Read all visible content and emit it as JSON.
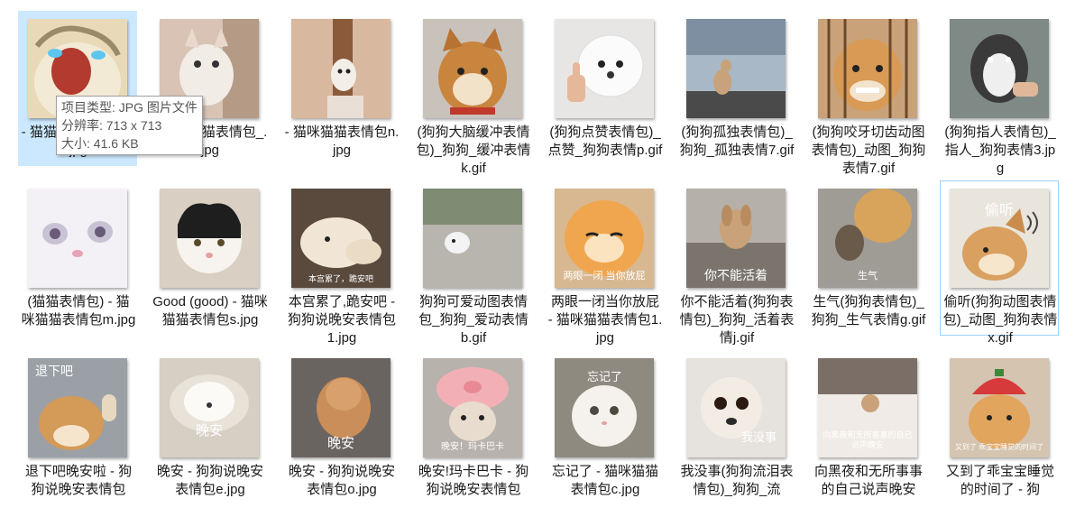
{
  "tooltip": {
    "type": "项目类型: JPG 图片文件",
    "resolution": "分辨率: 713 x 713",
    "size": "大小: 41.6 KB"
  },
  "files": [
    {
      "name": "- 猫猫猫猫表情包_.jpg",
      "overlay": ""
    },
    {
      "name": "- 猫咪猫猫表情包_.jpg",
      "overlay": ""
    },
    {
      "name": "- 猫咪猫猫表情包n.jpg",
      "overlay": ""
    },
    {
      "name": "(狗狗大脑缓冲表情包)_狗狗_缓冲表情k.gif",
      "overlay": ""
    },
    {
      "name": "(狗狗点赞表情包)_点赞_狗狗表情p.gif",
      "overlay": ""
    },
    {
      "name": "(狗狗孤独表情包)_狗狗_孤独表情7.gif",
      "overlay": ""
    },
    {
      "name": "(狗狗咬牙切齿动图表情包)_动图_狗狗表情7.gif",
      "overlay": ""
    },
    {
      "name": "(狗狗指人表情包)_指人_狗狗表情3.jpg",
      "overlay": ""
    },
    {
      "name": "(猫猫表情包) - 猫咪猫猫表情包m.jpg",
      "overlay": ""
    },
    {
      "name": "Good (good) - 猫咪猫猫表情包s.jpg",
      "overlay": ""
    },
    {
      "name": "本宫累了,跪安吧 - 狗狗说晚安表情包1.jpg",
      "overlay": "本宫累了，跪安吧"
    },
    {
      "name": "狗狗可爱动图表情包_狗狗_爱动表情b.gif",
      "overlay": ""
    },
    {
      "name": "两眼一闭当你放屁 - 猫咪猫猫表情包1.jpg",
      "overlay": "两眼一闭 当你放屁"
    },
    {
      "name": "你不能活着(狗狗表情包)_狗狗_活着表情j.gif",
      "overlay": "你不能活着"
    },
    {
      "name": "生气(狗狗表情包)_狗狗_生气表情g.gif",
      "overlay": "生气"
    },
    {
      "name": "偷听(狗狗动图表情包)_动图_狗狗表情x.gif",
      "overlay": "偷听"
    },
    {
      "name": "退下吧晚安啦 - 狗狗说晚安表情包",
      "overlay": "退下吧"
    },
    {
      "name": "晚安 - 狗狗说晚安表情包e.jpg",
      "overlay": "晚安"
    },
    {
      "name": "晚安 - 狗狗说晚安表情包o.jpg",
      "overlay": "晚安"
    },
    {
      "name": "晚安!玛卡巴卡 - 狗狗说晚安表情包",
      "overlay": "晚安！玛卡巴卡"
    },
    {
      "name": "忘记了 - 猫咪猫猫表情包c.jpg",
      "overlay": "忘记了"
    },
    {
      "name": "我没事(狗狗流泪表情包)_狗狗_流",
      "overlay": "我没事"
    },
    {
      "name": "向黑夜和无所事事的自己说声晚安",
      "overlay": "向黑夜和无所事事的自己说声晚安"
    },
    {
      "name": "又到了乖宝宝睡觉的时间了 - 狗",
      "overlay": "又到了 乖宝宝睡觉的时间了"
    }
  ]
}
